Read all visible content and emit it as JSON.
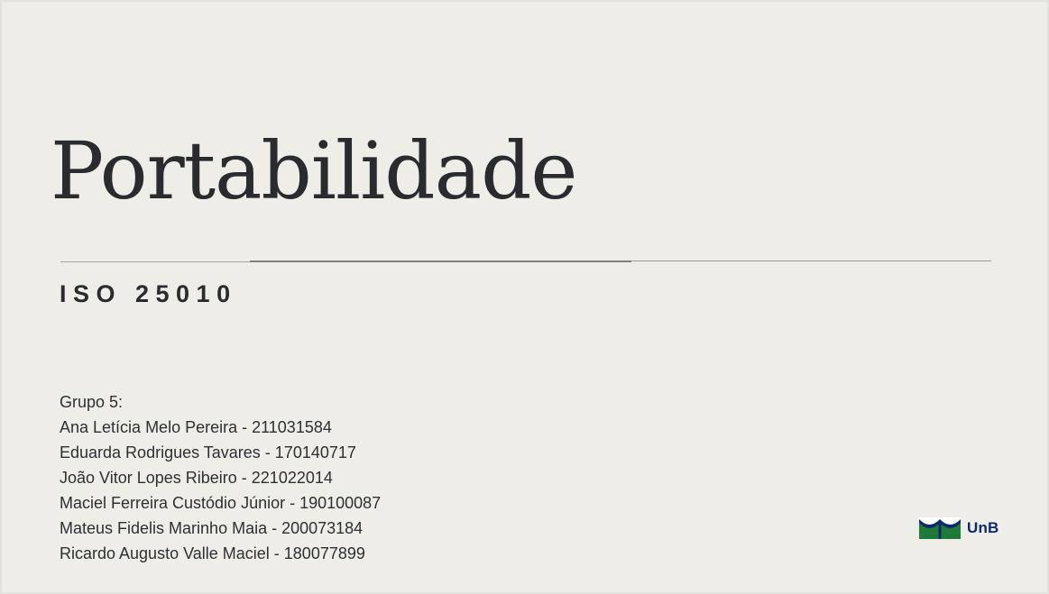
{
  "slide": {
    "title": "Portabilidade",
    "subtitle": "ISO 25010",
    "group_label": "Grupo 5:",
    "members": [
      "Ana Letícia Melo Pereira - 211031584",
      "Eduarda Rodrigues Tavares - 170140717",
      "João Vitor Lopes Ribeiro - 221022014",
      "Maciel Ferreira Custódio Júnior - 190100087",
      "Mateus Fidelis Marinho Maia - 200073184",
      "Ricardo Augusto Valle Maciel - 180077899"
    ],
    "logo": {
      "icon": "unb-emblem-icon",
      "text": "UnB",
      "colors": {
        "green": "#1f7a3a",
        "blue": "#0f2a6b"
      }
    }
  },
  "colors": {
    "background": "#eeede7",
    "text": "#2a2b2f",
    "divider": "#8d8d8a"
  }
}
